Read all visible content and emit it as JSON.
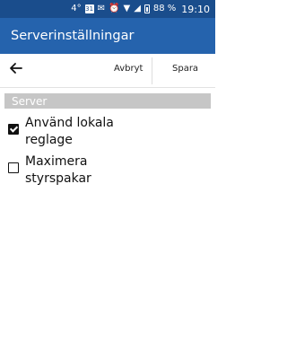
{
  "status_bar": {
    "signal_label": "4°",
    "calendar_day": "31",
    "battery": "88 %",
    "time": "19:10"
  },
  "app_bar": {
    "title": "Serverinställningar"
  },
  "toolbar": {
    "back_icon": "arrow-left-icon",
    "cancel_label": "Avbryt",
    "save_label": "Spara"
  },
  "section": {
    "header": "Server"
  },
  "options": [
    {
      "label": "Använd lokala reglage",
      "checked": true
    },
    {
      "label": "Maximera styrspakar",
      "checked": false
    }
  ]
}
